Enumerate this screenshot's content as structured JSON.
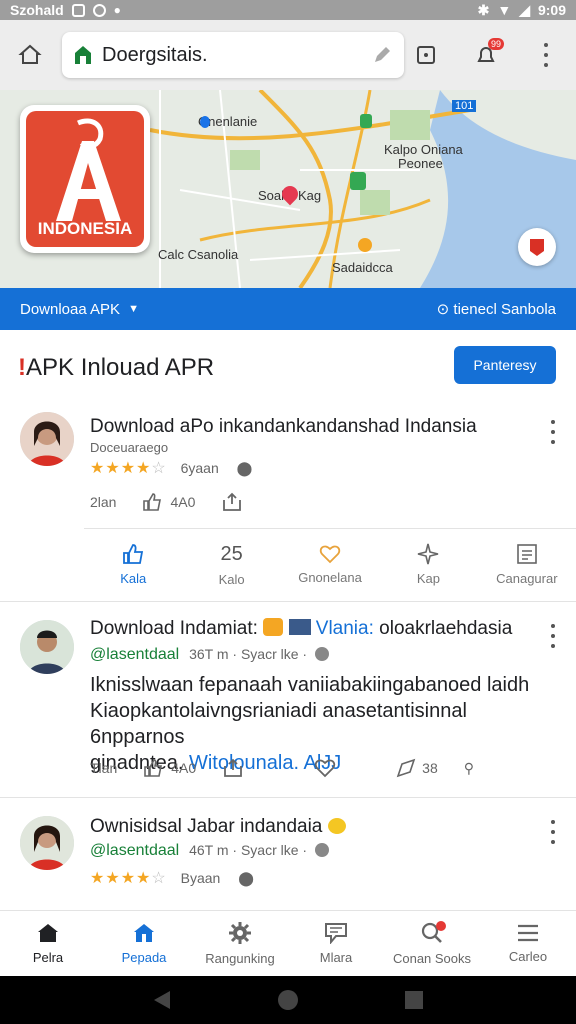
{
  "status_bar": {
    "carrier": "Szohald",
    "time": "9:09"
  },
  "browser": {
    "url": "Doergsitais.",
    "notification_count": "99"
  },
  "map": {
    "labels": [
      "Onenlanie",
      "Kalpo Oniana",
      "Peonee",
      "Soal",
      "Kag",
      "Calc Csanolia",
      "Sadaidcca",
      "101"
    ],
    "logo_text": "INDONESIA"
  },
  "blue_bar": {
    "dropdown_label": "Downloaa APK",
    "location_label": "tienecl Sanbola"
  },
  "header": {
    "title_mark": "!",
    "title": "APK Inlouad APR",
    "primary_button": "Panteresy"
  },
  "posts": [
    {
      "title": "Download aPo inkandankandanshad Indansia",
      "sub": "Doceuaraego",
      "stars": "★★★★",
      "stars_off": "☆",
      "stars_meta": "6yaan",
      "meta_left": "2lan",
      "meta_count": "4A0"
    },
    {
      "title_prefix": "Download Indamiat:",
      "title_link": "Vlania:",
      "title_suffix": "oloakrlaehdasia",
      "handle": "@lasentdaal",
      "handle_meta": "36T m · Syacr lke ·",
      "body_line1": "Iknisslwaan fepanaah vaniiabakiingabanoed laidh",
      "body_line2": "Kiaopkantolaivngsrianiadi anasetantisinnal 6npparnos",
      "body_line3": "ginadntea.",
      "body_link": "Witolounala. AlJJ",
      "meta_left": "Tlan",
      "meta_count": "4A0",
      "share_count": "38"
    },
    {
      "title": "Ownisidsal Jabar indandaia",
      "handle": "@lasentdaal",
      "handle_meta": "46T m · Syacr lke ·",
      "stars": "★★★★",
      "stars_off": "☆",
      "stars_meta": "Byaan"
    }
  ],
  "actions": [
    {
      "label": "Kala",
      "value": ""
    },
    {
      "label": "Kalo",
      "value": "25"
    },
    {
      "label": "Gnonelana",
      "value": ""
    },
    {
      "label": "Kap",
      "value": ""
    },
    {
      "label": "Canagurar",
      "value": ""
    }
  ],
  "bottom_nav": [
    {
      "label": "Pelra",
      "icon": "home-icon"
    },
    {
      "label": "Pepada",
      "icon": "house-icon"
    },
    {
      "label": "Rangunking",
      "icon": "gear-icon"
    },
    {
      "label": "Mlara",
      "icon": "message-icon"
    },
    {
      "label": "Conan Sooks",
      "icon": "search-icon"
    },
    {
      "label": "Carleo",
      "icon": "menu-icon"
    }
  ],
  "colors": {
    "accent": "#1570d6",
    "star": "#f4a623",
    "logo": "#e24a32"
  }
}
